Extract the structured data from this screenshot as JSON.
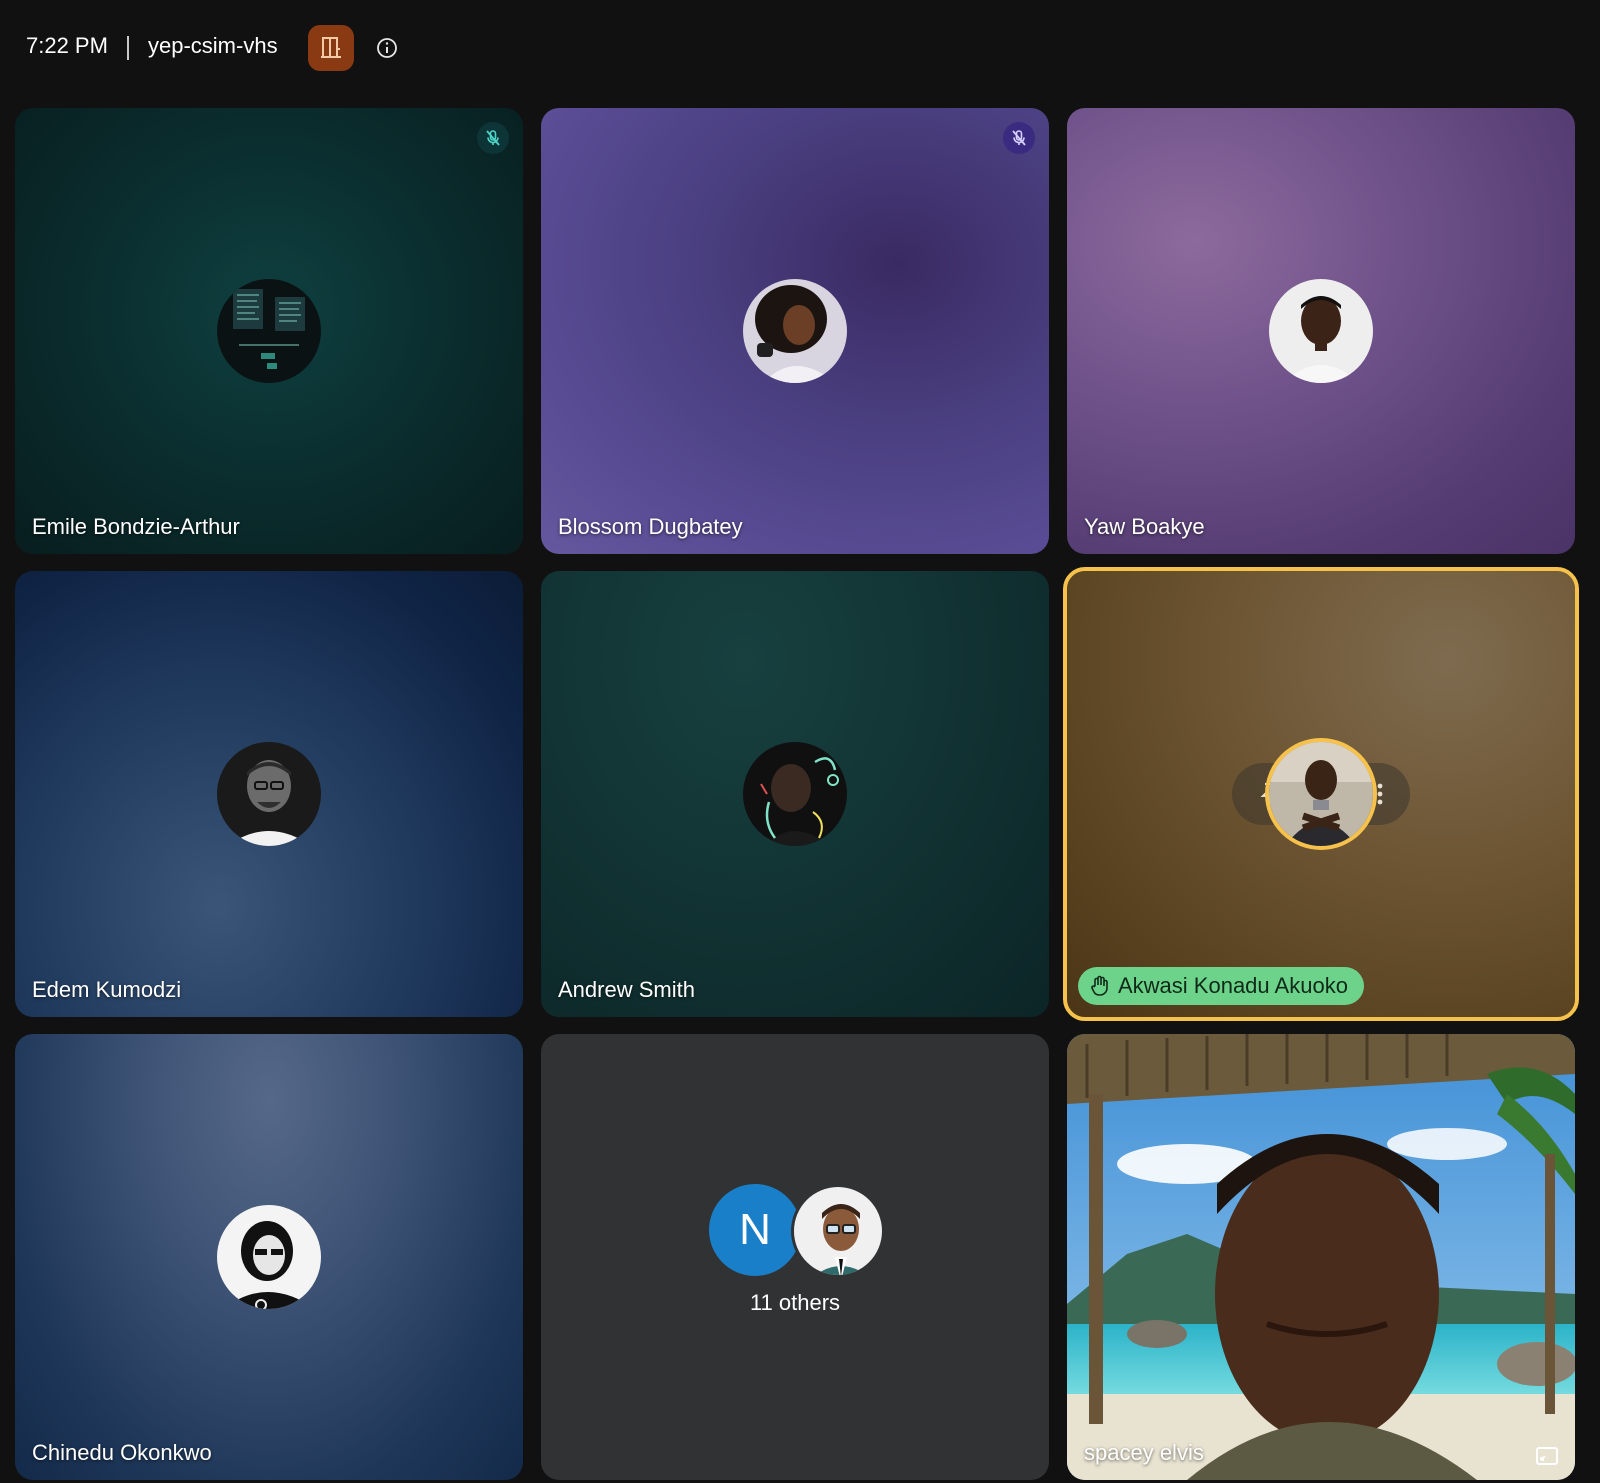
{
  "topbar": {
    "time": "7:22 PM",
    "meeting_code": "yep-csim-vhs",
    "room_icon": "door-icon",
    "info_icon": "info-icon"
  },
  "colors": {
    "active_speaker_ring": "#f6c24b",
    "raised_hand_badge": "#6ed38a",
    "room_button": "#8a3a12",
    "others_avatar": "#1a7fc9"
  },
  "tiles": [
    {
      "name": "Emile Bondzie-Arthur",
      "muted": true
    },
    {
      "name": "Blossom Dugbatey",
      "muted": true
    },
    {
      "name": "Yaw Boakye",
      "muted": false
    },
    {
      "name": "Edem Kumodzi",
      "muted": false
    },
    {
      "name": "Andrew Smith",
      "muted": false
    },
    {
      "name": "Akwasi Konadu Akuoko",
      "hand_raised": true,
      "active": true
    },
    {
      "name": "Chinedu Okonkwo",
      "muted": false
    },
    {
      "others": {
        "initial": "N",
        "label": "11 others"
      }
    },
    {
      "name": "spacey elvis",
      "video": true
    }
  ]
}
